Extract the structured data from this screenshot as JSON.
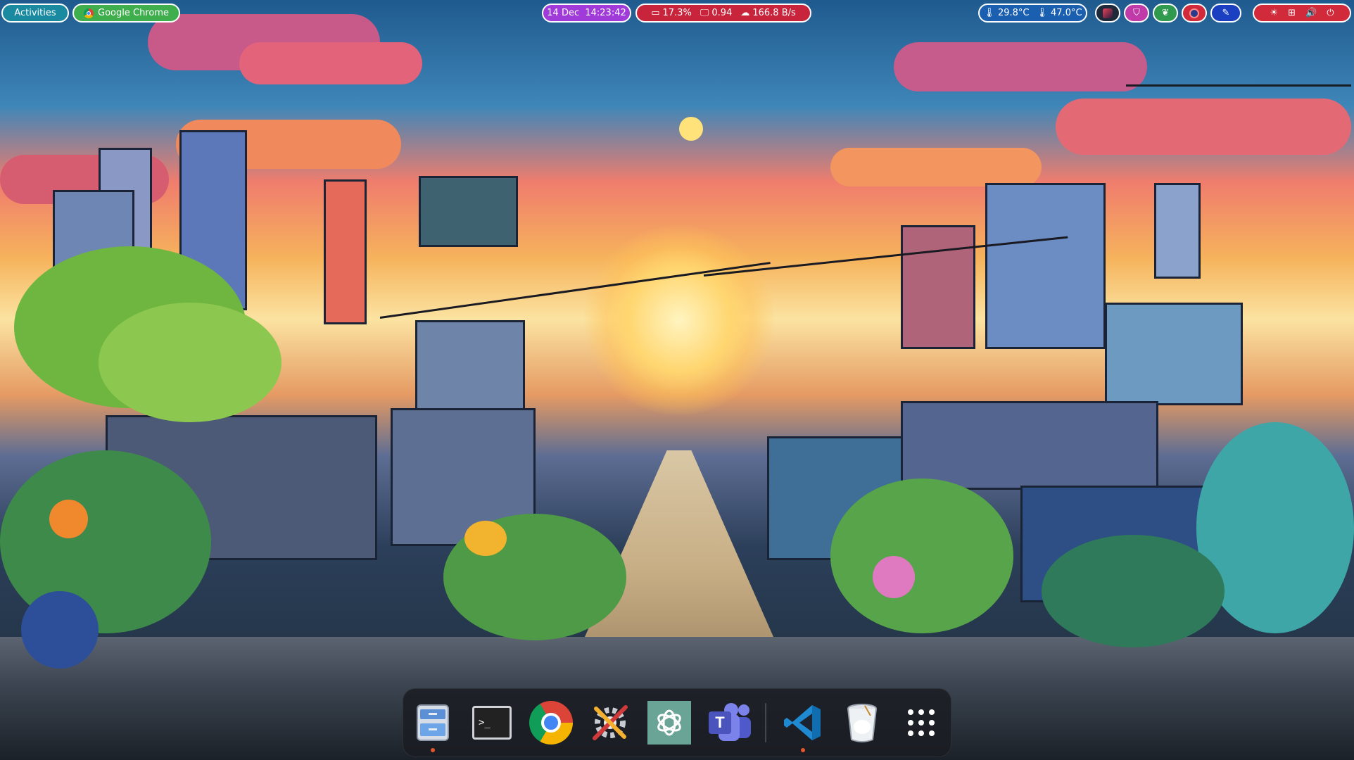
{
  "topbar": {
    "activities_label": "Activities",
    "active_app_label": "Google Chrome",
    "datetime": "14 Dec  14:23:42",
    "system_stats": {
      "cpu": "17.3%",
      "load": "0.94",
      "network": "166.8 B/s"
    },
    "temperatures": {
      "temp1": "29.8°C",
      "temp2": "47.0°C"
    },
    "colors": {
      "activities_bg": "#1a8aa0",
      "active_app_bg": "#3fae4d",
      "datetime_bg": "#a03ad8",
      "stats_bg": "#c8243b",
      "temps_bg": "#1a5fb0",
      "status_bg": "#1e2a3a"
    },
    "status_icons": [
      "tray-app-icon",
      "shield-icon",
      "leaf-icon",
      "record-icon",
      "pen-icon"
    ],
    "system_icons": [
      "brightness-icon",
      "network-icon",
      "volume-icon",
      "power-icon"
    ]
  },
  "dock": {
    "items": [
      {
        "name": "files",
        "running": true
      },
      {
        "name": "terminal",
        "running": false
      },
      {
        "name": "google-chrome",
        "running": false
      },
      {
        "name": "settings-tools",
        "running": false
      },
      {
        "name": "chatgpt",
        "running": false
      },
      {
        "name": "microsoft-teams",
        "running": false
      },
      {
        "name": "visual-studio-code",
        "running": true
      },
      {
        "name": "trash",
        "running": false
      },
      {
        "name": "show-applications",
        "running": false
      }
    ],
    "terminal_prompt": ">_",
    "teams_letter": "T"
  }
}
